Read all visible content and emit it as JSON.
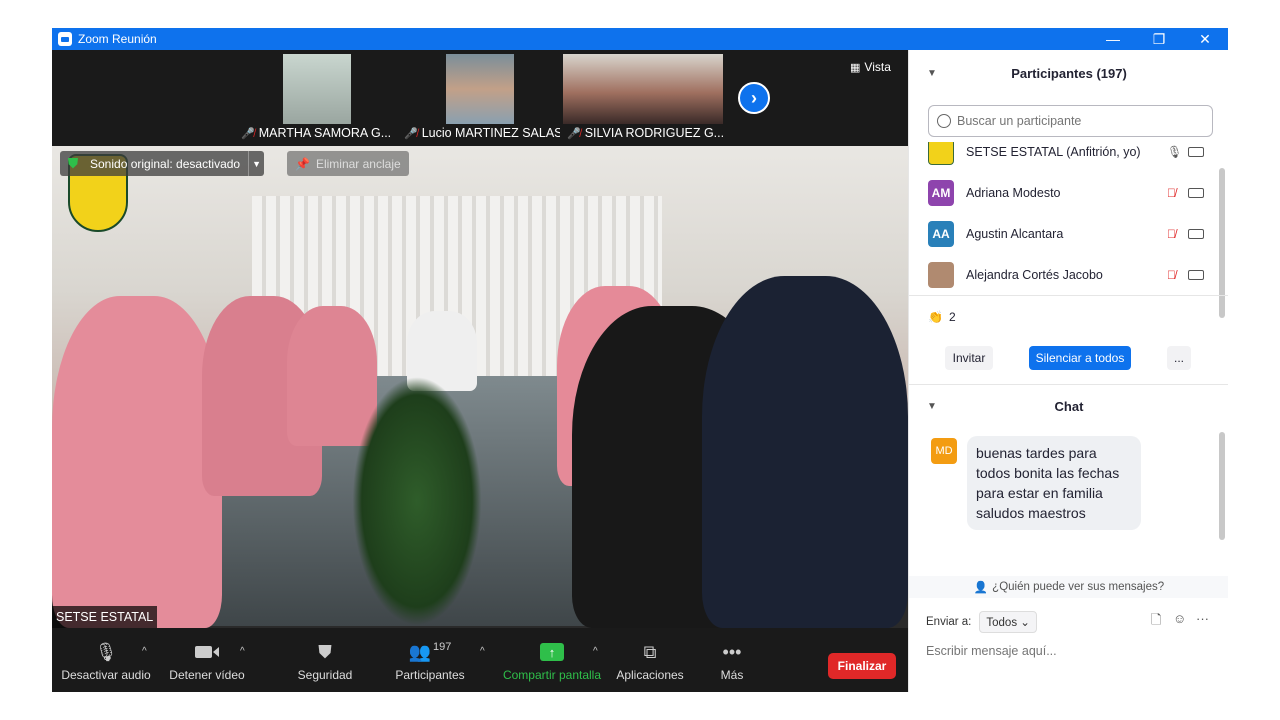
{
  "window": {
    "title": "Zoom Reunión",
    "minimize": "—",
    "restore": "❐",
    "close": "✕"
  },
  "video": {
    "thumbnails": [
      {
        "name": "MARTHA SAMORA G..."
      },
      {
        "name": "Lucio MARTINEZ SALAS"
      },
      {
        "name": "SILVIA RODRIGUEZ G..."
      }
    ],
    "view_label": "Vista",
    "original_sound": "Sonido original: desactivado",
    "unpin_label": "Eliminar anclaje",
    "active_speaker": "SETSE ESTATAL"
  },
  "toolbar": {
    "mute_label": "Desactivar audio",
    "video_label": "Detener vídeo",
    "security_label": "Seguridad",
    "participants_label": "Participantes",
    "participants_count": "197",
    "share_label": "Compartir pantalla",
    "apps_label": "Aplicaciones",
    "more_label": "Más",
    "end_label": "Finalizar",
    "colors": {
      "share": "#2fbf4a",
      "end": "#e02828",
      "accent": "#0e72ed"
    }
  },
  "participants": {
    "header": "Participantes (197)",
    "search_placeholder": "Buscar un participante",
    "list": [
      {
        "name": "SETSE ESTATAL (Anfitrión, yo)",
        "initials": "",
        "color": "#f2d21a",
        "muted": false
      },
      {
        "name": "Adriana Modesto",
        "initials": "AM",
        "color": "#8e44ad",
        "muted": true
      },
      {
        "name": "Agustin Alcantara",
        "initials": "AA",
        "color": "#2980b9",
        "muted": true
      },
      {
        "name": "Alejandra Cortés Jacobo",
        "initials": "",
        "color": "#b08a70",
        "muted": true
      }
    ],
    "reaction_count": "2",
    "invite_label": "Invitar",
    "mute_all_label": "Silenciar a todos",
    "more_label": "..."
  },
  "chat": {
    "header": "Chat",
    "messages": [
      {
        "initials": "MD",
        "lines": [
          "buenas tardes para",
          "todos bonita las fechas",
          "para estar en familia",
          "saludos maestros"
        ]
      }
    ],
    "who_can_see": "¿Quién puede ver sus mensajes?",
    "send_to_label": "Enviar a:",
    "send_to_value": "Todos",
    "input_placeholder": "Escribir mensaje aquí..."
  }
}
